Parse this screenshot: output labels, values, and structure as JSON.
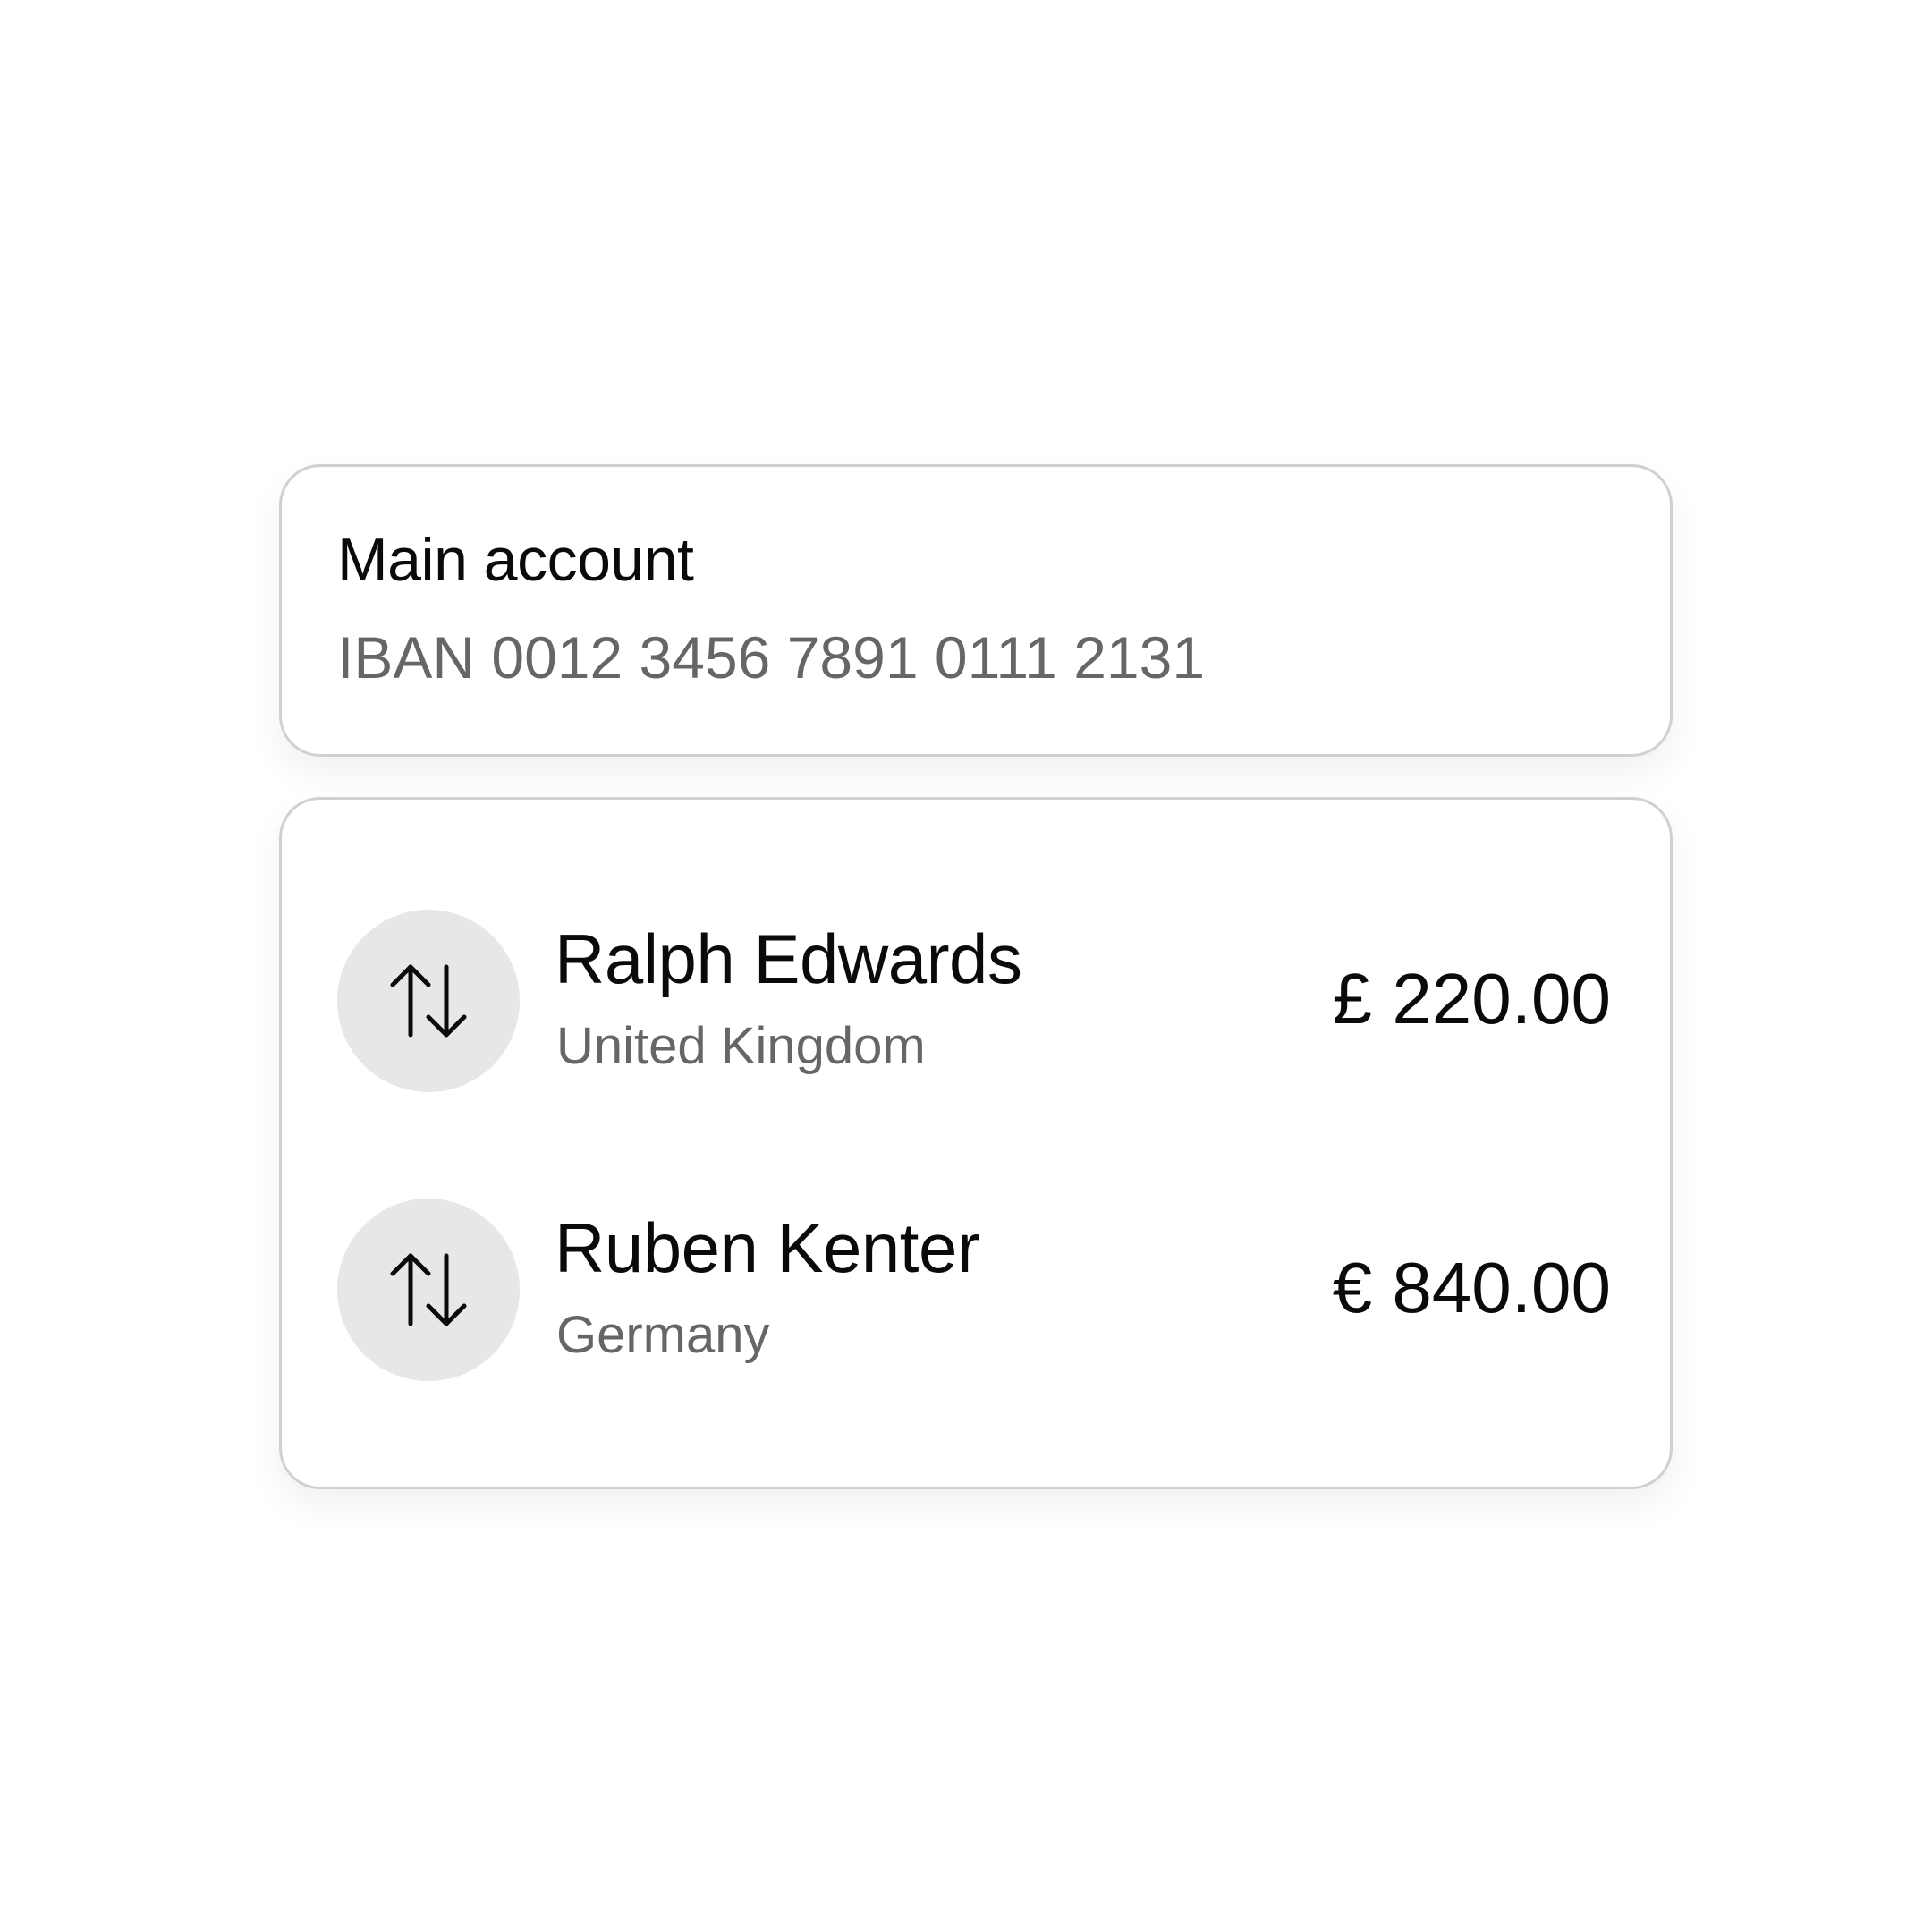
{
  "account": {
    "title": "Main account",
    "iban": "IBAN 0012 3456 7891 0111 2131"
  },
  "transactions": [
    {
      "name": "Ralph Edwards",
      "country": "United Kingdom",
      "amount": "£ 220.00",
      "icon": "transfer-arrows-icon"
    },
    {
      "name": "Ruben Kenter",
      "country": "Germany",
      "amount": "€ 840.00",
      "icon": "transfer-arrows-icon"
    }
  ],
  "colors": {
    "text_primary": "#0a0a0a",
    "text_secondary": "#666666",
    "card_border": "#d0d0d0",
    "icon_background": "#e7e7e7"
  }
}
